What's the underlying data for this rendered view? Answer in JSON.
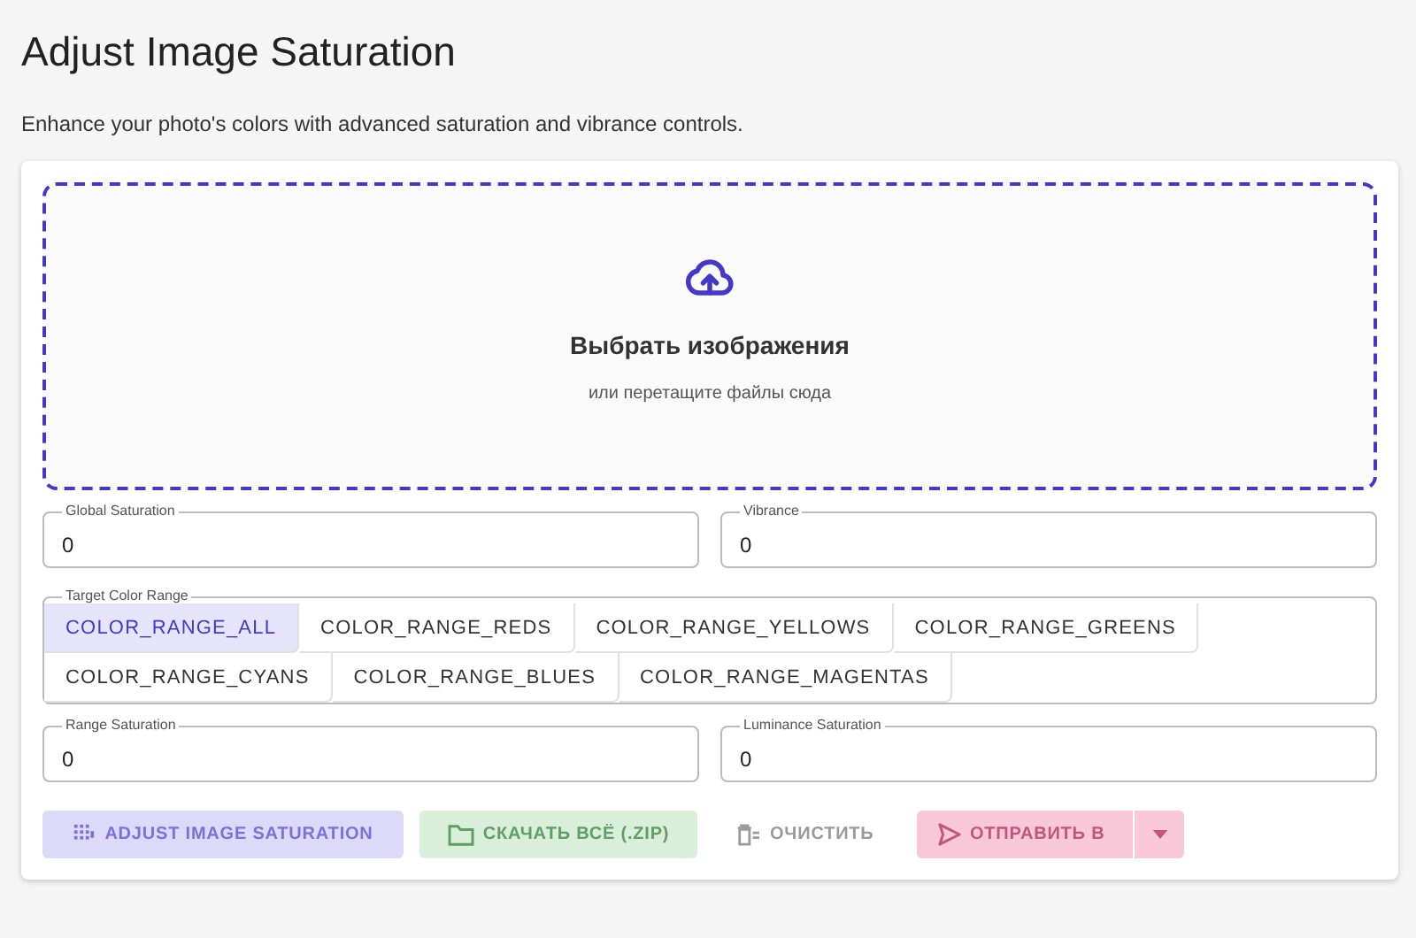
{
  "title": "Adjust Image Saturation",
  "description": "Enhance your photo's colors with advanced saturation and vibrance controls.",
  "dropzone": {
    "title": "Выбрать изображения",
    "hint": "или перетащите файлы сюда"
  },
  "fields_top": [
    {
      "label": "Global Saturation",
      "value": "0"
    },
    {
      "label": "Vibrance",
      "value": "0"
    }
  ],
  "color_range": {
    "label": "Target Color Range",
    "options": [
      {
        "label": "COLOR_RANGE_ALL",
        "selected": true
      },
      {
        "label": "COLOR_RANGE_REDS",
        "selected": false
      },
      {
        "label": "COLOR_RANGE_YELLOWS",
        "selected": false
      },
      {
        "label": "COLOR_RANGE_GREENS",
        "selected": false
      },
      {
        "label": "COLOR_RANGE_CYANS",
        "selected": false
      },
      {
        "label": "COLOR_RANGE_BLUES",
        "selected": false
      },
      {
        "label": "COLOR_RANGE_MAGENTAS",
        "selected": false
      }
    ]
  },
  "fields_bottom": [
    {
      "label": "Range Saturation",
      "value": "0"
    },
    {
      "label": "Luminance Saturation",
      "value": "0"
    }
  ],
  "buttons": [
    {
      "kind": "primary",
      "label": "ADJUST IMAGE SATURATION",
      "disabled": true
    },
    {
      "kind": "success",
      "label": "СКАЧАТЬ ВСЁ (.ZIP)",
      "disabled": true
    },
    {
      "kind": "text",
      "label": "ОЧИСТИТЬ",
      "disabled": true
    },
    {
      "kind": "split",
      "label": "ОТПРАВИТЬ В",
      "disabled": true
    }
  ]
}
